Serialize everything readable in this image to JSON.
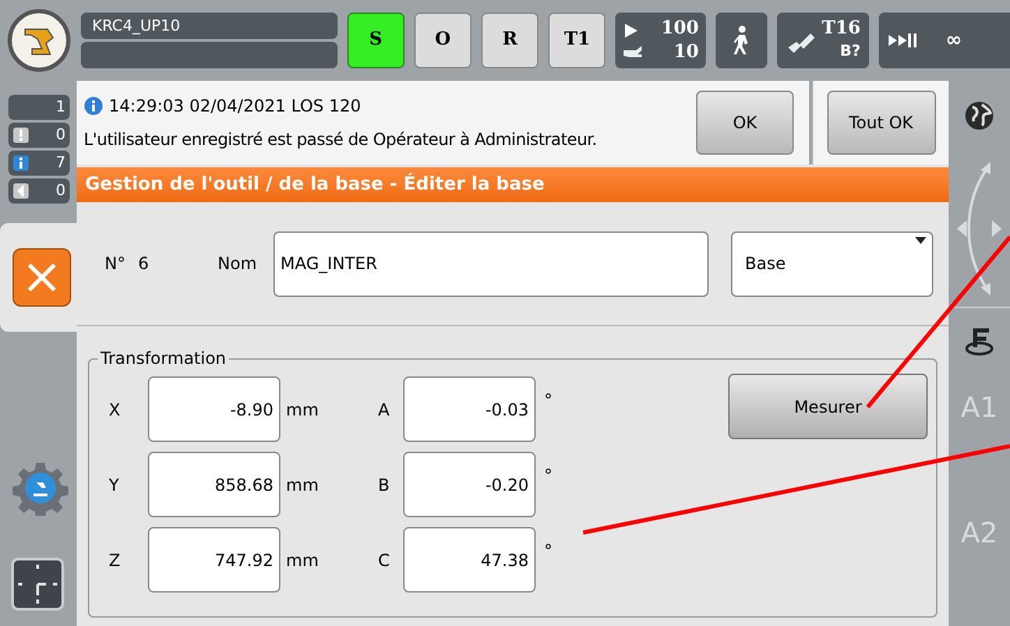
{
  "header": {
    "robot_name": "KRC4_UP10",
    "modes": [
      {
        "label": "S",
        "selected": true
      },
      {
        "label": "O",
        "selected": false
      },
      {
        "label": "R",
        "selected": false
      },
      {
        "label": "T1",
        "selected": false
      }
    ],
    "override": {
      "program": "100",
      "jog": "10"
    },
    "tool": {
      "tool": "T16",
      "base": "B?"
    },
    "increment": "∞"
  },
  "counters": [
    {
      "kind": "plain",
      "count": "1"
    },
    {
      "kind": "warning",
      "count": "0"
    },
    {
      "kind": "info",
      "count": "7"
    },
    {
      "kind": "dialog",
      "count": "0"
    }
  ],
  "message": {
    "header": "14:29:03 02/04/2021 LOS 120",
    "text": "L'utilisateur enregistré est passé de Opérateur à Administrateur.",
    "buttons": [
      "OK",
      "Tout OK"
    ]
  },
  "title": "Gestion de l'outil / de la base - Éditer la base",
  "form": {
    "number_label": "N°",
    "number": "6",
    "name_label": "Nom",
    "name": "MAG_INTER",
    "type": "Base"
  },
  "transformation": {
    "legend": "Transformation",
    "rows": [
      {
        "label": "X",
        "value": "-8.90",
        "unit": "mm",
        "label2": "A",
        "value2": "-0.03",
        "unit2": "°"
      },
      {
        "label": "Y",
        "value": "858.68",
        "unit": "mm",
        "label2": "B",
        "value2": "-0.20",
        "unit2": "°"
      },
      {
        "label": "Z",
        "value": "747.92",
        "unit": "mm",
        "label2": "C",
        "value2": "47.38",
        "unit2": "°"
      }
    ],
    "measure_button": "Mesurer"
  },
  "jog_axes": [
    "A1",
    "A2"
  ]
}
